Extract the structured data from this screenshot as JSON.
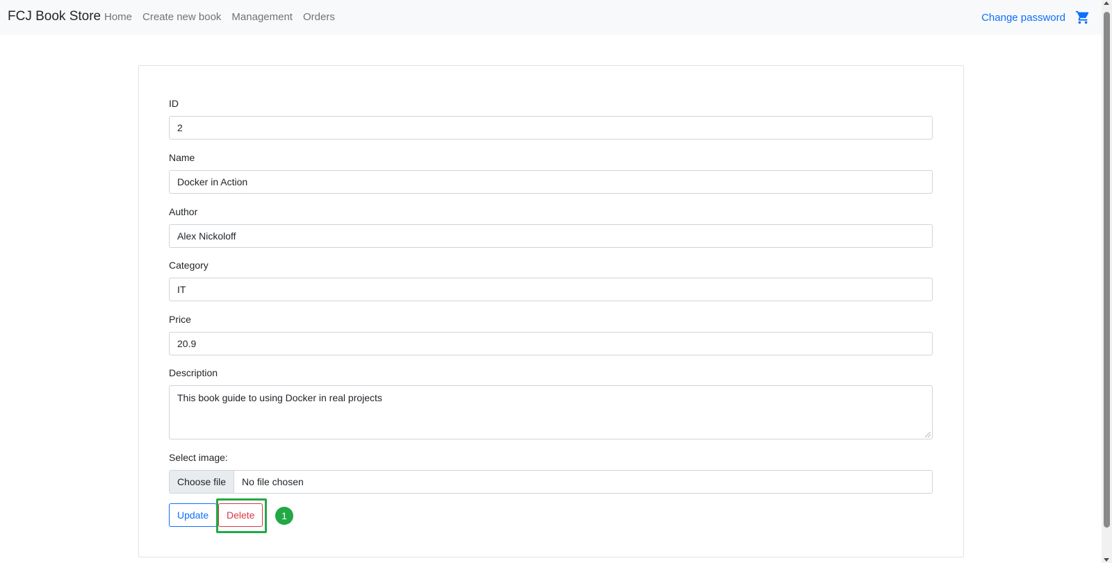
{
  "navbar": {
    "brand": "FCJ Book Store",
    "links": [
      "Home",
      "Create new book",
      "Management",
      "Orders"
    ],
    "change_password": "Change password",
    "cart_icon": "cart-icon",
    "link_color": "#0d6efd"
  },
  "form": {
    "id": {
      "label": "ID",
      "value": "2"
    },
    "name": {
      "label": "Name",
      "value": "Docker in Action"
    },
    "author": {
      "label": "Author",
      "value": "Alex Nickoloff"
    },
    "category": {
      "label": "Category",
      "value": "IT"
    },
    "price": {
      "label": "Price",
      "value": "20.9"
    },
    "description": {
      "label": "Description",
      "value": "This book guide to using Docker in real projects"
    },
    "image": {
      "label": "Select image:",
      "button": "Choose file",
      "status": "No file chosen"
    },
    "update_label": "Update",
    "delete_label": "Delete"
  },
  "annotation": {
    "step": "1",
    "color": "#22a845"
  }
}
